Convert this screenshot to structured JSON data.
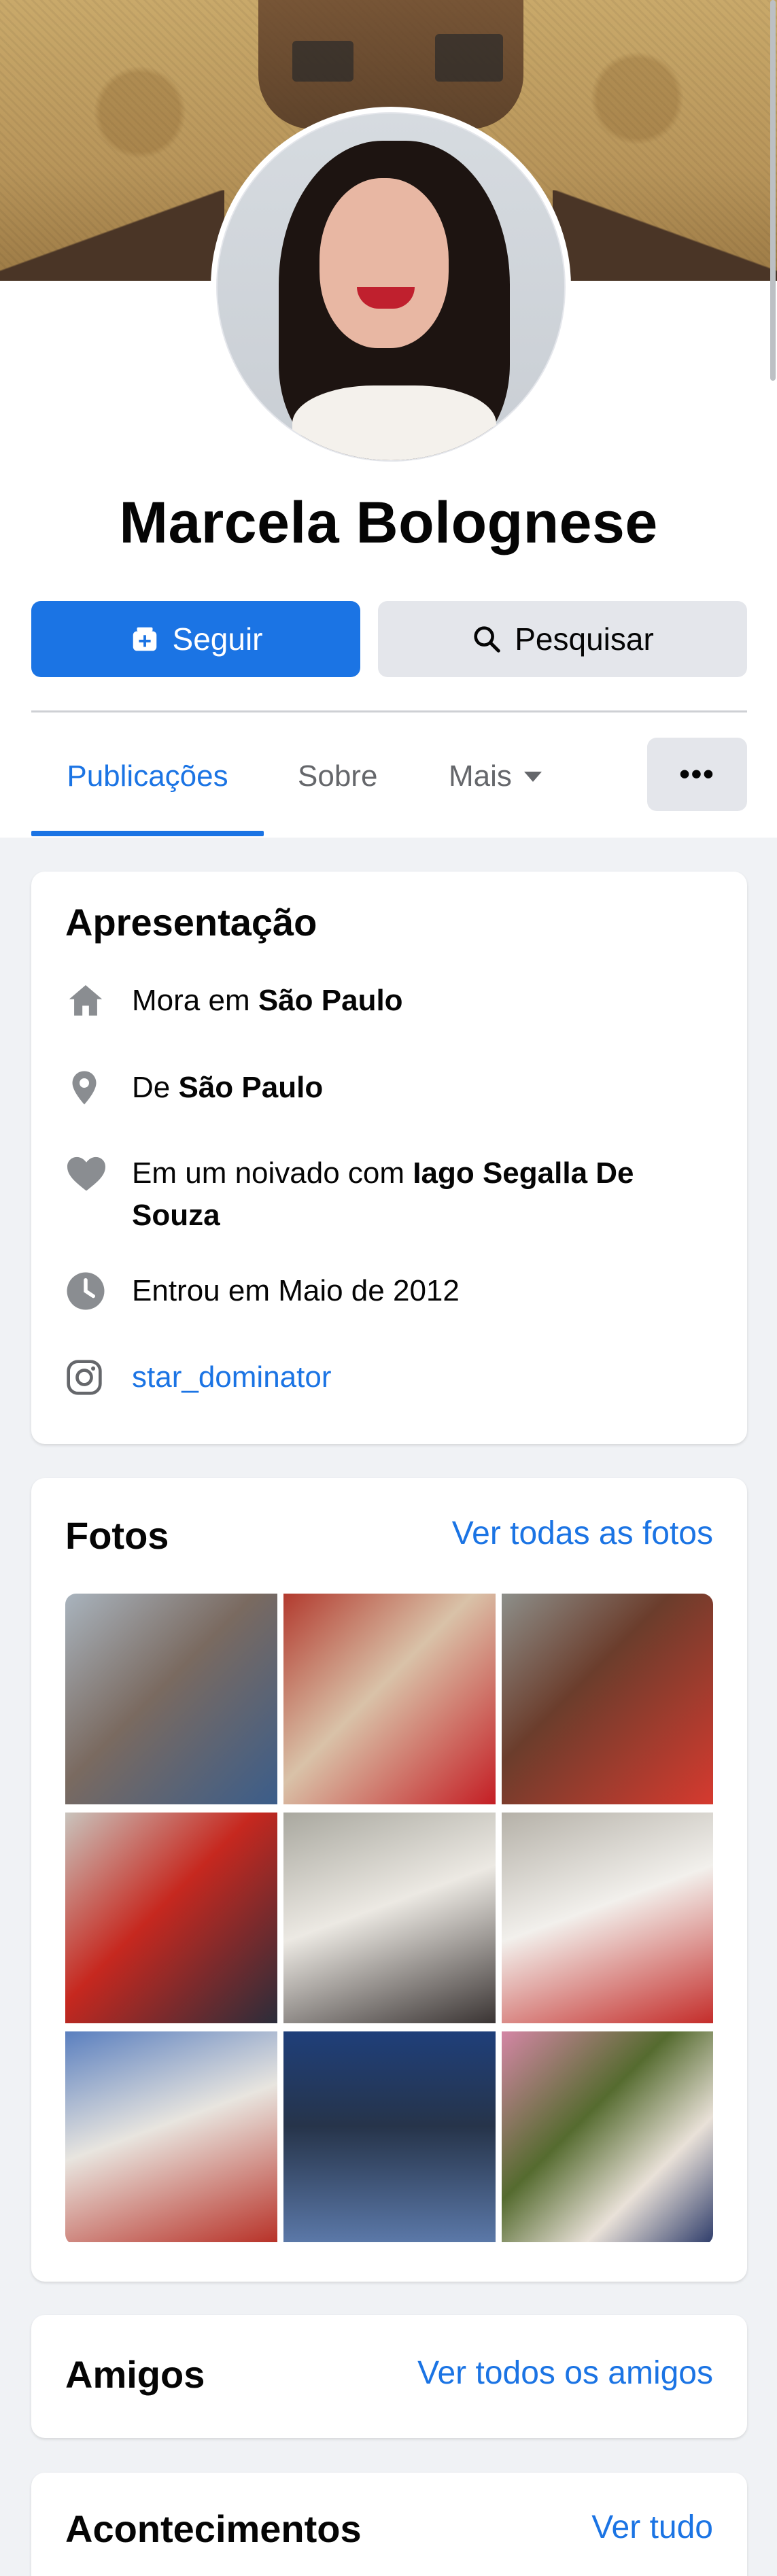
{
  "profile": {
    "name": "Marcela Bolognese",
    "follow_label": "Seguir",
    "search_label": "Pesquisar"
  },
  "tabs": [
    {
      "label": "Publicações",
      "active": true
    },
    {
      "label": "Sobre",
      "active": false
    },
    {
      "label": "Mais",
      "active": false
    }
  ],
  "more_button": "•••",
  "intro": {
    "title": "Apresentação",
    "lives_prefix": "Mora em ",
    "lives_city": "São Paulo",
    "from_prefix": "De ",
    "from_city": "São Paulo",
    "relationship_prefix": "Em um noivado com ",
    "relationship_partner": "Iago Segalla De Souza",
    "joined": "Entrou em Maio de 2012",
    "instagram": "star_dominator"
  },
  "photos": {
    "title": "Fotos",
    "see_all": "Ver todas as fotos",
    "count": 9
  },
  "friends": {
    "title": "Amigos",
    "see_all": "Ver todos os amigos"
  },
  "events": {
    "title": "Acontecimentos",
    "see_all": "Ver tudo"
  },
  "colors": {
    "accent": "#1b74e4",
    "background": "#f0f2f5",
    "secondary_button": "#e4e6eb",
    "muted_text": "#65676b"
  }
}
